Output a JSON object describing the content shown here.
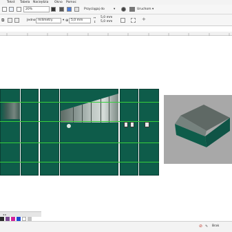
{
  "menubar": {
    "items": [
      {
        "label": "Tekst"
      },
      {
        "label": "Tabela"
      },
      {
        "label": "Narzędzia"
      },
      {
        "label": "Okno"
      },
      {
        "label": "Pomoc"
      }
    ]
  },
  "toolbar": {
    "zoom_value": "20%",
    "snap_label": "Przyciągaj do",
    "launch_label": "Uruchom",
    "units_label": "Jednostki:",
    "units_value": "milimetry",
    "nudge_value": "5,0 mm",
    "dup_x": "5,0 mm",
    "dup_y": "5,0 mm"
  },
  "palette": {
    "colors": [
      "#2b2b2b",
      "#7a4a8f",
      "#d0219a",
      "#1f4bd1",
      "#ffffff",
      "#c4c4c4"
    ]
  },
  "statusbar": {
    "fill_label": "Brak"
  },
  "colors": {
    "panel_green": "#0e5c4a",
    "guide_green": "#35d03b",
    "preview_bg": "#a8a8a8"
  }
}
